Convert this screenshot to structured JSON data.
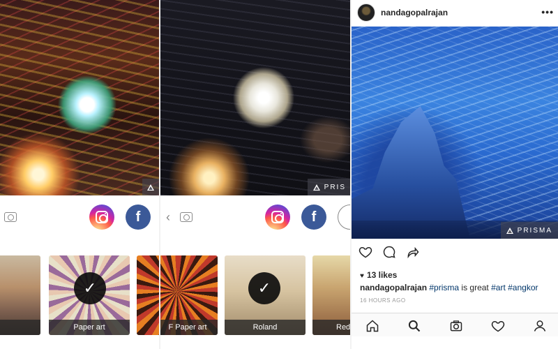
{
  "left_panel": {
    "badge_icon": "prisma-triangle-icon",
    "share_icons": [
      "camera-icon",
      "instagram-icon",
      "facebook-icon"
    ],
    "filters": [
      {
        "label": "and"
      },
      {
        "label": "Paper art",
        "selected": true
      }
    ]
  },
  "mid_panel": {
    "badge_text": "PRIS",
    "share_icons": [
      "back-chevron-icon",
      "camera-icon",
      "instagram-icon",
      "facebook-icon",
      "share-icon"
    ],
    "chevron": "‹",
    "filters": [
      {
        "label": "F Paper art"
      },
      {
        "label": "Roland",
        "selected": true
      },
      {
        "label": "Red"
      }
    ]
  },
  "instagram": {
    "username": "nandagopalrajan",
    "more": "•••",
    "badge_text": "PRISMA",
    "likes": "13 likes",
    "caption": {
      "user": "nandagopalrajan",
      "parts": [
        {
          "text": "#prisma",
          "tag": true
        },
        {
          "text": " is great ",
          "tag": false
        },
        {
          "text": "#art",
          "tag": true
        },
        {
          "text": " ",
          "tag": false
        },
        {
          "text": "#angkor",
          "tag": true
        }
      ]
    },
    "timestamp": "16 HOURS AGO",
    "nav": [
      "home-icon",
      "search-icon",
      "camera-icon",
      "heart-icon",
      "profile-icon"
    ],
    "tag_color": "#003569"
  },
  "colors": {
    "facebook": "#3b5998"
  },
  "fb_letter": "f",
  "check": "✓"
}
